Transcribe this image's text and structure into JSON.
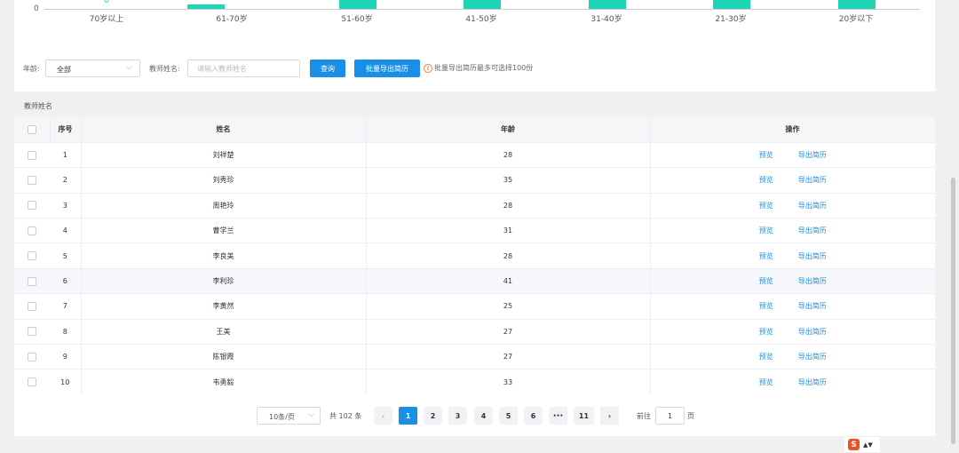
{
  "chart_data": {
    "type": "bar",
    "categories": [
      "70岁以上",
      "61-70岁",
      "51-60岁",
      "41-50岁",
      "31-40岁",
      "21-30岁",
      "20岁以下"
    ],
    "y_tick_label": "0",
    "top_value_label": "0",
    "bar_color": "#1ed5b5"
  },
  "filters": {
    "age_label": "年龄:",
    "age_value": "全部",
    "name_label": "教师姓名:",
    "name_placeholder": "请输入教师姓名",
    "search_button": "查询",
    "batch_export_button": "批量导出简历",
    "tip_text": "批量导出简历最多可选择100份"
  },
  "section_title": "教师姓名",
  "table": {
    "headers": {
      "index": "序号",
      "name": "姓名",
      "age": "年龄",
      "actions": "操作"
    },
    "preview_label": "预览",
    "export_label": "导出简历",
    "rows": [
      {
        "index": "1",
        "name": "刘祥楚",
        "age": "28"
      },
      {
        "index": "2",
        "name": "刘秀珍",
        "age": "35"
      },
      {
        "index": "3",
        "name": "周艳玲",
        "age": "28"
      },
      {
        "index": "4",
        "name": "曹学兰",
        "age": "31"
      },
      {
        "index": "5",
        "name": "李良美",
        "age": "28"
      },
      {
        "index": "6",
        "name": "李利珍",
        "age": "41"
      },
      {
        "index": "7",
        "name": "李黄然",
        "age": "25"
      },
      {
        "index": "8",
        "name": "王美",
        "age": "27"
      },
      {
        "index": "9",
        "name": "陈银霞",
        "age": "27"
      },
      {
        "index": "10",
        "name": "韦勇毅",
        "age": "33"
      }
    ]
  },
  "pagination": {
    "page_size": "10条/页",
    "total": "共 102 条",
    "prev": "‹",
    "next": "›",
    "pages": [
      "1",
      "2",
      "3",
      "4",
      "5",
      "6",
      "•••",
      "11"
    ],
    "active_page": "1",
    "goto_label": "前往",
    "goto_value": "1",
    "page_suffix": "页"
  },
  "tray": {
    "icon_letter": "S",
    "arrows": "▲▼"
  }
}
